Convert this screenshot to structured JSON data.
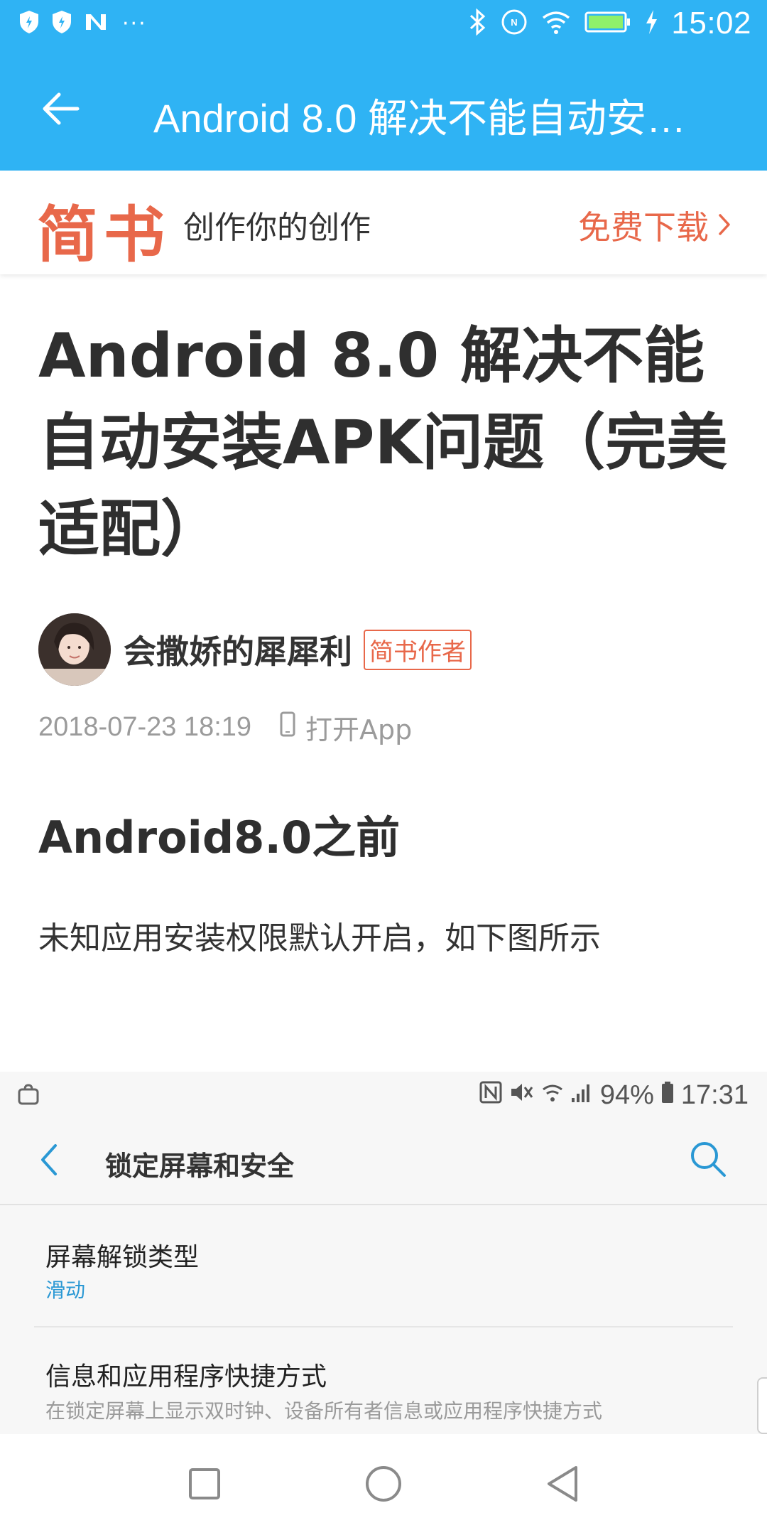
{
  "status_bar": {
    "time": "15:02",
    "left_icons": [
      "shield-icon",
      "shield-icon",
      "n-logo-icon"
    ],
    "overflow_dots": "···",
    "right_icons": [
      "bluetooth-icon",
      "nfc-icon",
      "wifi-icon",
      "battery-icon",
      "charging-bolt-icon"
    ]
  },
  "app_bar": {
    "title": "Android 8.0 解决不能自动安…",
    "background": "#2fb3f4"
  },
  "banner": {
    "logo": "简书",
    "slogan": "创作你的创作",
    "download_label": "免费下载",
    "accent": "#e8684a"
  },
  "article": {
    "title": "Android 8.0 解决不能自动安装APK问题（完美适配）",
    "author": "会撒娇的犀犀利",
    "author_badge": "简书作者",
    "date": "2018-07-23 18:19",
    "open_app_label": "打开App",
    "section_heading": "Android8.0之前",
    "paragraph": "未知应用安装权限默认开启，如下图所示"
  },
  "embedded_screenshot": {
    "status_time": "17:31",
    "battery": "94%",
    "header_title": "锁定屏幕和安全",
    "items": [
      {
        "title": "屏幕解锁类型",
        "subtitle": "滑动"
      },
      {
        "title": "信息和应用程序快捷方式",
        "subtitle": "在锁定屏幕上显示双时钟、设备所有者信息或应用程序快捷方式"
      }
    ]
  },
  "nav_bar": {
    "buttons": [
      "recents-square-icon",
      "home-circle-icon",
      "back-triangle-icon"
    ]
  }
}
